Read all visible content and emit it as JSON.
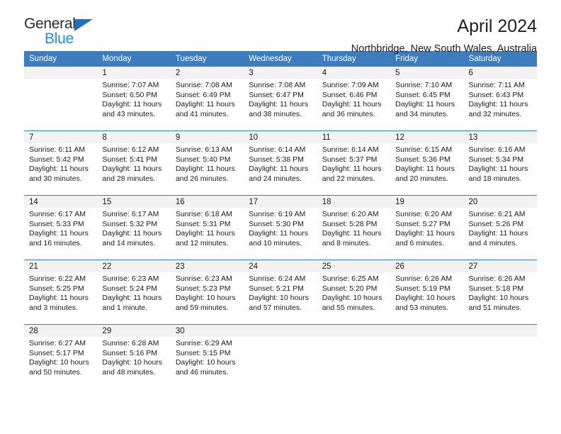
{
  "brand": {
    "name_dark": "General",
    "name_light": "Blue",
    "triangle_color": "#1f6fc4",
    "light_color": "#1f8fe0"
  },
  "header": {
    "title": "April 2024",
    "subtitle": "Northbridge, New South Wales, Australia"
  },
  "theme": {
    "header_bg": "#3d7dbf",
    "header_text": "#ffffff",
    "daynum_bg": "#f2f2f2",
    "row_border": "#3d7dbf"
  },
  "weekday_headers": [
    "Sunday",
    "Monday",
    "Tuesday",
    "Wednesday",
    "Thursday",
    "Friday",
    "Saturday"
  ],
  "weeks": [
    [
      {
        "day": "",
        "lines": []
      },
      {
        "day": "1",
        "lines": [
          "Sunrise: 7:07 AM",
          "Sunset: 6:50 PM",
          "Daylight: 11 hours",
          "and 43 minutes."
        ]
      },
      {
        "day": "2",
        "lines": [
          "Sunrise: 7:08 AM",
          "Sunset: 6:49 PM",
          "Daylight: 11 hours",
          "and 41 minutes."
        ]
      },
      {
        "day": "3",
        "lines": [
          "Sunrise: 7:08 AM",
          "Sunset: 6:47 PM",
          "Daylight: 11 hours",
          "and 38 minutes."
        ]
      },
      {
        "day": "4",
        "lines": [
          "Sunrise: 7:09 AM",
          "Sunset: 6:46 PM",
          "Daylight: 11 hours",
          "and 36 minutes."
        ]
      },
      {
        "day": "5",
        "lines": [
          "Sunrise: 7:10 AM",
          "Sunset: 6:45 PM",
          "Daylight: 11 hours",
          "and 34 minutes."
        ]
      },
      {
        "day": "6",
        "lines": [
          "Sunrise: 7:11 AM",
          "Sunset: 6:43 PM",
          "Daylight: 11 hours",
          "and 32 minutes."
        ]
      }
    ],
    [
      {
        "day": "7",
        "lines": [
          "Sunrise: 6:11 AM",
          "Sunset: 5:42 PM",
          "Daylight: 11 hours",
          "and 30 minutes."
        ]
      },
      {
        "day": "8",
        "lines": [
          "Sunrise: 6:12 AM",
          "Sunset: 5:41 PM",
          "Daylight: 11 hours",
          "and 28 minutes."
        ]
      },
      {
        "day": "9",
        "lines": [
          "Sunrise: 6:13 AM",
          "Sunset: 5:40 PM",
          "Daylight: 11 hours",
          "and 26 minutes."
        ]
      },
      {
        "day": "10",
        "lines": [
          "Sunrise: 6:14 AM",
          "Sunset: 5:38 PM",
          "Daylight: 11 hours",
          "and 24 minutes."
        ]
      },
      {
        "day": "11",
        "lines": [
          "Sunrise: 6:14 AM",
          "Sunset: 5:37 PM",
          "Daylight: 11 hours",
          "and 22 minutes."
        ]
      },
      {
        "day": "12",
        "lines": [
          "Sunrise: 6:15 AM",
          "Sunset: 5:36 PM",
          "Daylight: 11 hours",
          "and 20 minutes."
        ]
      },
      {
        "day": "13",
        "lines": [
          "Sunrise: 6:16 AM",
          "Sunset: 5:34 PM",
          "Daylight: 11 hours",
          "and 18 minutes."
        ]
      }
    ],
    [
      {
        "day": "14",
        "lines": [
          "Sunrise: 6:17 AM",
          "Sunset: 5:33 PM",
          "Daylight: 11 hours",
          "and 16 minutes."
        ]
      },
      {
        "day": "15",
        "lines": [
          "Sunrise: 6:17 AM",
          "Sunset: 5:32 PM",
          "Daylight: 11 hours",
          "and 14 minutes."
        ]
      },
      {
        "day": "16",
        "lines": [
          "Sunrise: 6:18 AM",
          "Sunset: 5:31 PM",
          "Daylight: 11 hours",
          "and 12 minutes."
        ]
      },
      {
        "day": "17",
        "lines": [
          "Sunrise: 6:19 AM",
          "Sunset: 5:30 PM",
          "Daylight: 11 hours",
          "and 10 minutes."
        ]
      },
      {
        "day": "18",
        "lines": [
          "Sunrise: 6:20 AM",
          "Sunset: 5:28 PM",
          "Daylight: 11 hours",
          "and 8 minutes."
        ]
      },
      {
        "day": "19",
        "lines": [
          "Sunrise: 6:20 AM",
          "Sunset: 5:27 PM",
          "Daylight: 11 hours",
          "and 6 minutes."
        ]
      },
      {
        "day": "20",
        "lines": [
          "Sunrise: 6:21 AM",
          "Sunset: 5:26 PM",
          "Daylight: 11 hours",
          "and 4 minutes."
        ]
      }
    ],
    [
      {
        "day": "21",
        "lines": [
          "Sunrise: 6:22 AM",
          "Sunset: 5:25 PM",
          "Daylight: 11 hours",
          "and 3 minutes."
        ]
      },
      {
        "day": "22",
        "lines": [
          "Sunrise: 6:23 AM",
          "Sunset: 5:24 PM",
          "Daylight: 11 hours",
          "and 1 minute."
        ]
      },
      {
        "day": "23",
        "lines": [
          "Sunrise: 6:23 AM",
          "Sunset: 5:23 PM",
          "Daylight: 10 hours",
          "and 59 minutes."
        ]
      },
      {
        "day": "24",
        "lines": [
          "Sunrise: 6:24 AM",
          "Sunset: 5:21 PM",
          "Daylight: 10 hours",
          "and 57 minutes."
        ]
      },
      {
        "day": "25",
        "lines": [
          "Sunrise: 6:25 AM",
          "Sunset: 5:20 PM",
          "Daylight: 10 hours",
          "and 55 minutes."
        ]
      },
      {
        "day": "26",
        "lines": [
          "Sunrise: 6:26 AM",
          "Sunset: 5:19 PM",
          "Daylight: 10 hours",
          "and 53 minutes."
        ]
      },
      {
        "day": "27",
        "lines": [
          "Sunrise: 6:26 AM",
          "Sunset: 5:18 PM",
          "Daylight: 10 hours",
          "and 51 minutes."
        ]
      }
    ],
    [
      {
        "day": "28",
        "lines": [
          "Sunrise: 6:27 AM",
          "Sunset: 5:17 PM",
          "Daylight: 10 hours",
          "and 50 minutes."
        ]
      },
      {
        "day": "29",
        "lines": [
          "Sunrise: 6:28 AM",
          "Sunset: 5:16 PM",
          "Daylight: 10 hours",
          "and 48 minutes."
        ]
      },
      {
        "day": "30",
        "lines": [
          "Sunrise: 6:29 AM",
          "Sunset: 5:15 PM",
          "Daylight: 10 hours",
          "and 46 minutes."
        ]
      },
      {
        "day": "",
        "lines": []
      },
      {
        "day": "",
        "lines": []
      },
      {
        "day": "",
        "lines": []
      },
      {
        "day": "",
        "lines": []
      }
    ]
  ]
}
